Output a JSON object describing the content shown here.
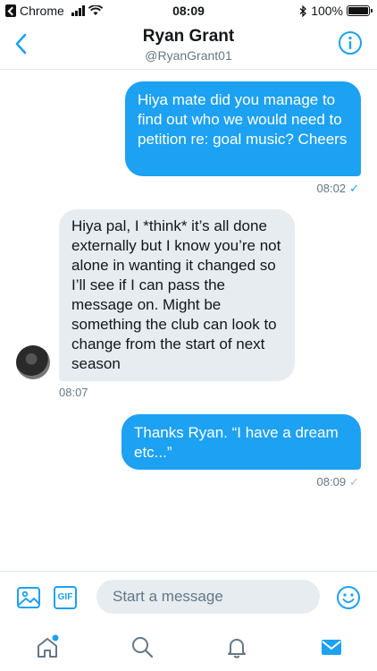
{
  "status_bar": {
    "back_app": "Chrome",
    "time": "08:09",
    "battery_percent": "100%",
    "battery_level": 1.0
  },
  "header": {
    "name": "Ryan Grant",
    "handle": "@RyanGrant01"
  },
  "messages": [
    {
      "direction": "out",
      "text": "Hiya mate did you manage to find out who we would need to petition re: goal music? Cheers",
      "time": "08:02",
      "status_icon": "✓"
    },
    {
      "direction": "in",
      "text": "Hiya pal, I *think* it’s all done externally but I know you’re not alone in wanting it changed so I’ll see if I can pass the message on. Might be something the club can look to change from the start of next season",
      "time": "08:07"
    },
    {
      "direction": "out",
      "text": "Thanks Ryan. “I have a dream etc...”",
      "time": "08:09",
      "status_icon": "✓"
    }
  ],
  "composer": {
    "placeholder": "Start a message",
    "gif_label": "GIF"
  },
  "colors": {
    "accent": "#1da1f2",
    "incoming_bubble": "#e6ecf0"
  }
}
